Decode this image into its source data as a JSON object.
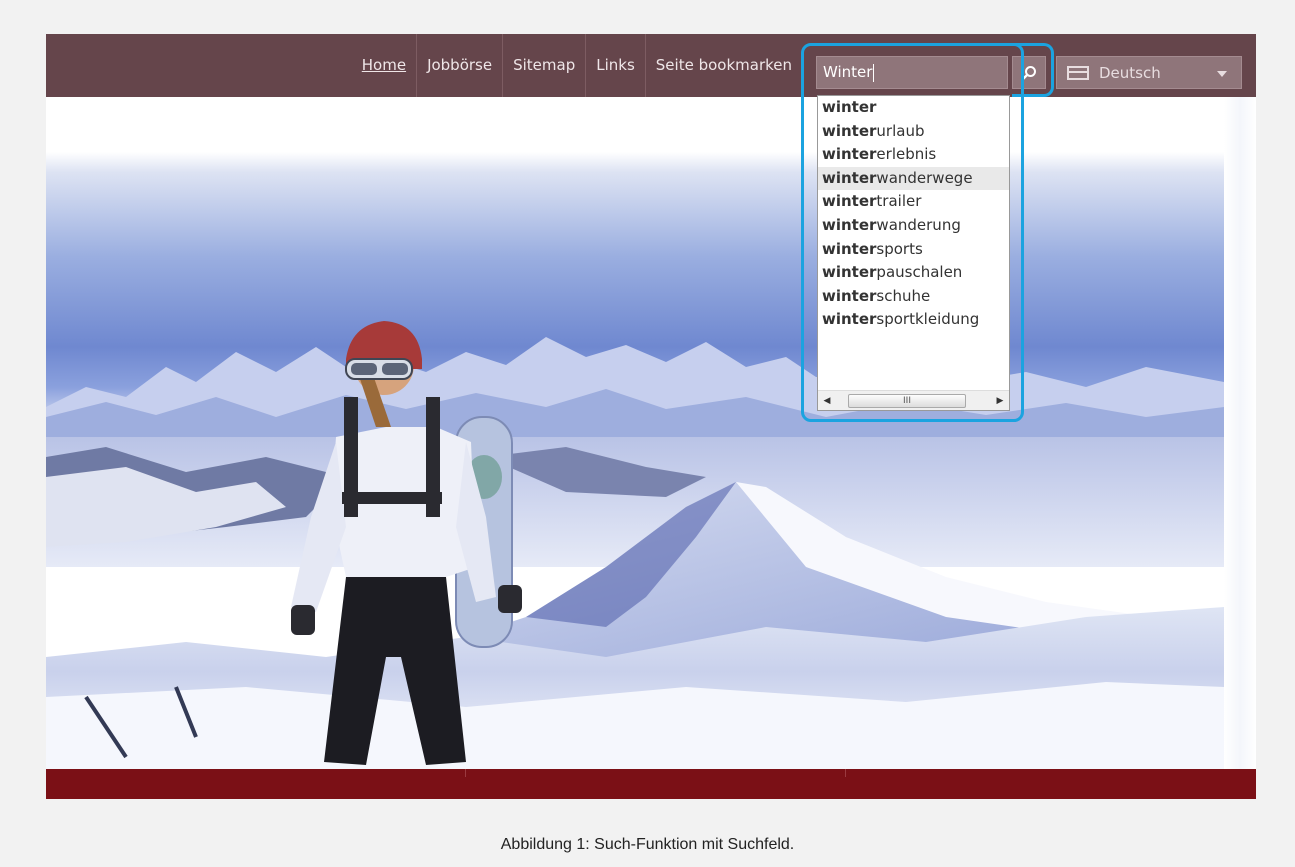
{
  "nav": {
    "items": [
      {
        "label": "Home",
        "active": true
      },
      {
        "label": "Jobbörse",
        "active": false
      },
      {
        "label": "Sitemap",
        "active": false
      },
      {
        "label": "Links",
        "active": false
      },
      {
        "label": "Seite bookmarken",
        "active": false
      }
    ]
  },
  "search": {
    "value": "Winter",
    "button_icon": "search-icon"
  },
  "language": {
    "selected": "Deutsch",
    "icon": "monitor-flag-icon"
  },
  "suggestions": {
    "prefix": "winter",
    "items": [
      {
        "bold": "winter",
        "rest": ""
      },
      {
        "bold": "winter",
        "rest": "urlaub"
      },
      {
        "bold": "winter",
        "rest": "erlebnis"
      },
      {
        "bold": "winter",
        "rest": "wanderwege"
      },
      {
        "bold": "winter",
        "rest": "trailer"
      },
      {
        "bold": "winter",
        "rest": "wanderung"
      },
      {
        "bold": "winter",
        "rest": "sports"
      },
      {
        "bold": "winter",
        "rest": "pauschalen"
      },
      {
        "bold": "winter",
        "rest": "schuhe"
      },
      {
        "bold": "winter",
        "rest": "sportkleidung"
      }
    ],
    "highlighted_index": 3,
    "scrollbar_grip": "III"
  },
  "caption": "Abbildung 1: Such-Funktion mit Suchfeld.",
  "colors": {
    "topbar": "#65454b",
    "stripe": "#7b1016",
    "highlight_outline": "#1ba3e0"
  }
}
